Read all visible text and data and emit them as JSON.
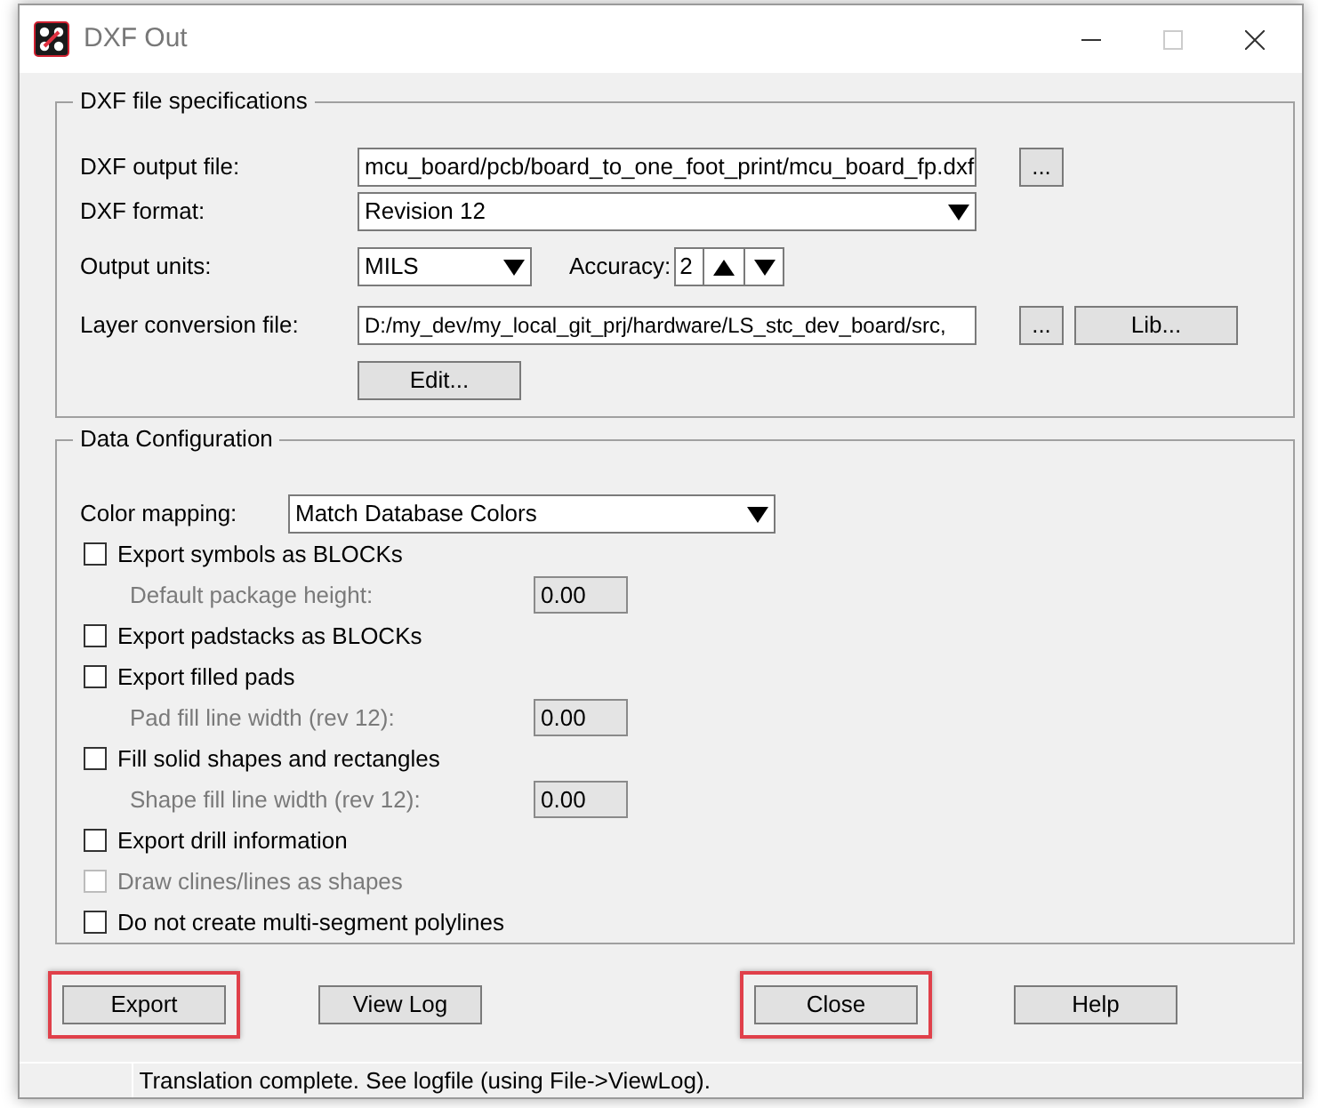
{
  "window": {
    "title": "DXF Out",
    "maximize_disabled": true
  },
  "spec_group": {
    "title": "DXF file specifications",
    "output_file": {
      "label": "DXF output file:",
      "value": "mcu_board/pcb/board_to_one_foot_print/mcu_board_fp.dxf",
      "browse": "..."
    },
    "format": {
      "label": "DXF format:",
      "value": "Revision 12"
    },
    "units": {
      "label": "Output units:",
      "value": "MILS"
    },
    "accuracy": {
      "label": "Accuracy:",
      "value": "2"
    },
    "layer_file": {
      "label": "Layer conversion file:",
      "value": "D:/my_dev/my_local_git_prj/hardware/LS_stc_dev_board/src,",
      "browse": "...",
      "lib": "Lib..."
    },
    "edit_button": "Edit..."
  },
  "data_group": {
    "title": "Data Configuration",
    "color_mapping": {
      "label": "Color mapping:",
      "value": "Match Database Colors"
    },
    "options": [
      {
        "kind": "checkbox",
        "label": "Export symbols as BLOCKs",
        "checked": false,
        "disabled": false
      },
      {
        "kind": "field",
        "label": "Default package height:",
        "value": "0.00",
        "disabled": true
      },
      {
        "kind": "checkbox",
        "label": "Export padstacks as BLOCKs",
        "checked": false,
        "disabled": false
      },
      {
        "kind": "checkbox",
        "label": "Export filled pads",
        "checked": false,
        "disabled": false
      },
      {
        "kind": "field",
        "label": "Pad fill line width (rev 12):",
        "value": "0.00",
        "disabled": true
      },
      {
        "kind": "checkbox",
        "label": "Fill solid shapes and rectangles",
        "checked": false,
        "disabled": false
      },
      {
        "kind": "field",
        "label": "Shape fill line width (rev 12):",
        "value": "0.00",
        "disabled": true
      },
      {
        "kind": "checkbox",
        "label": "Export drill information",
        "checked": false,
        "disabled": false
      },
      {
        "kind": "checkbox",
        "label": "Draw clines/lines as shapes",
        "checked": false,
        "disabled": true
      },
      {
        "kind": "checkbox",
        "label": "Do not create multi-segment polylines",
        "checked": false,
        "disabled": false
      }
    ]
  },
  "buttons": [
    {
      "label": "Export",
      "highlighted": true
    },
    {
      "label": "View Log",
      "highlighted": false
    },
    {
      "label": "Close",
      "highlighted": true
    },
    {
      "label": "Help",
      "highlighted": false
    }
  ],
  "status_bar": {
    "text": "Translation complete. See logfile (using File->ViewLog)."
  }
}
